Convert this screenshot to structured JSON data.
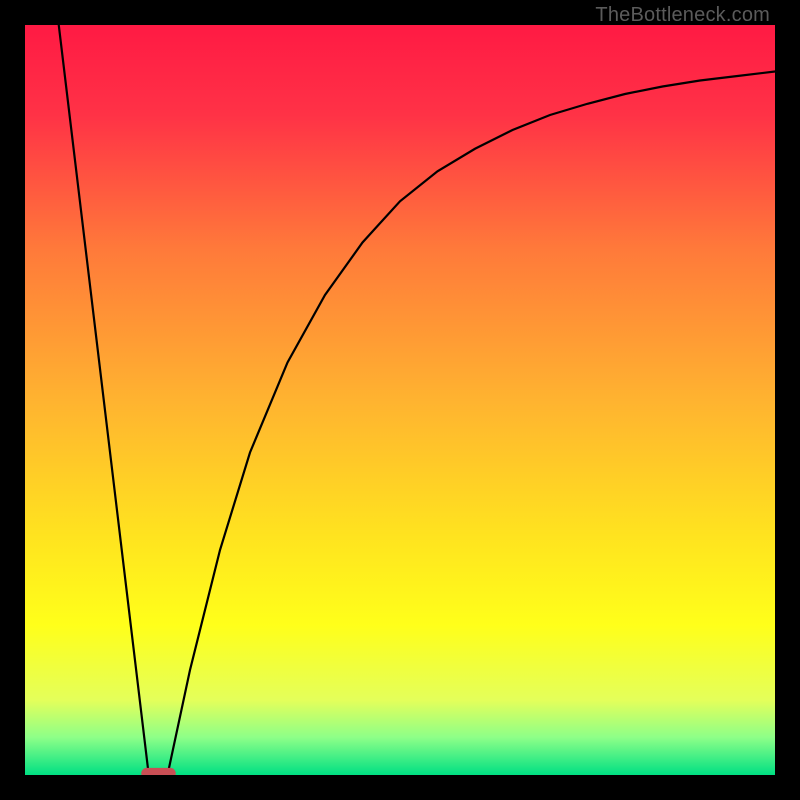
{
  "attribution": "TheBottleneck.com",
  "chart_data": {
    "type": "line",
    "title": "",
    "xlabel": "",
    "ylabel": "",
    "xlim": [
      0,
      100
    ],
    "ylim": [
      0,
      100
    ],
    "grid": false,
    "legend": false,
    "gradient_stops": [
      {
        "offset": 0.0,
        "color": "#ff1a44"
      },
      {
        "offset": 0.12,
        "color": "#ff3246"
      },
      {
        "offset": 0.3,
        "color": "#ff7a3a"
      },
      {
        "offset": 0.5,
        "color": "#ffb330"
      },
      {
        "offset": 0.68,
        "color": "#ffe31f"
      },
      {
        "offset": 0.8,
        "color": "#ffff1a"
      },
      {
        "offset": 0.9,
        "color": "#e4ff5a"
      },
      {
        "offset": 0.95,
        "color": "#8dff88"
      },
      {
        "offset": 1.0,
        "color": "#00e083"
      }
    ],
    "series": [
      {
        "name": "left-branch",
        "x": [
          4.5,
          16.5
        ],
        "y": [
          100,
          0
        ]
      },
      {
        "name": "right-branch",
        "x": [
          19,
          22,
          26,
          30,
          35,
          40,
          45,
          50,
          55,
          60,
          65,
          70,
          75,
          80,
          85,
          90,
          95,
          100
        ],
        "y": [
          0,
          14,
          30,
          43,
          55,
          64,
          71,
          76.5,
          80.5,
          83.5,
          86,
          88,
          89.5,
          90.8,
          91.8,
          92.6,
          93.2,
          93.8
        ]
      }
    ],
    "optimal_marker": {
      "x_center": 17.8,
      "x_halfwidth": 2.3,
      "y": 0.22,
      "color": "#c94f55"
    }
  }
}
